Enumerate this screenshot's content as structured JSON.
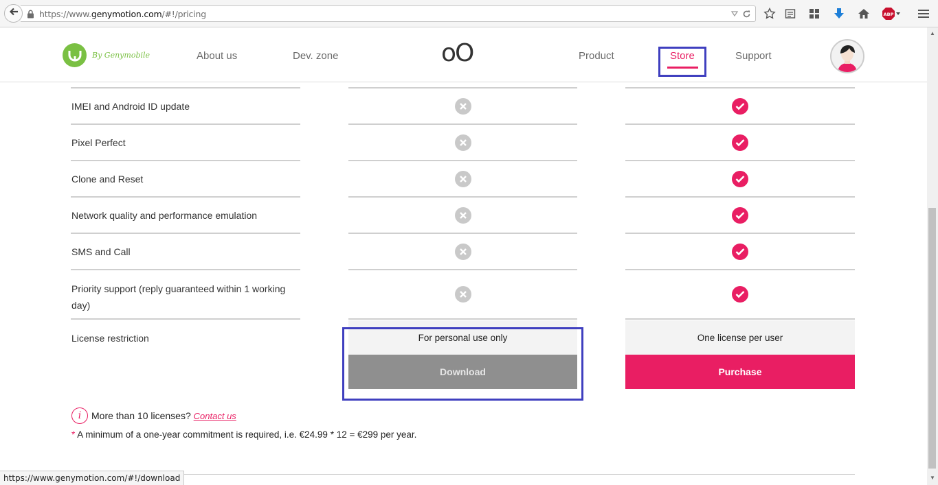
{
  "browser": {
    "url_prefix": "https://www.",
    "url_domain": "genymotion.com",
    "url_path": "/#!/pricing",
    "status_url": "https://www.genymotion.com/#!/download"
  },
  "header": {
    "logo_text": "By Genymobile",
    "nav_about": "About us",
    "nav_devzone": "Dev. zone",
    "brand_mark": "oO",
    "nav_product": "Product",
    "nav_store": "Store",
    "nav_support": "Support"
  },
  "features": [
    {
      "label": "IMEI and Android ID update",
      "free": false,
      "paid": true
    },
    {
      "label": "Pixel Perfect",
      "free": false,
      "paid": true
    },
    {
      "label": "Clone and Reset",
      "free": false,
      "paid": true
    },
    {
      "label": "Network quality and performance emulation",
      "free": false,
      "paid": true
    },
    {
      "label": "SMS and Call",
      "free": false,
      "paid": true
    },
    {
      "label": "Priority support (reply guaranteed within 1 working day)",
      "free": false,
      "paid": true
    }
  ],
  "license": {
    "label": "License restriction",
    "free_text": "For personal use only",
    "paid_text": "One license per user",
    "download_label": "Download",
    "purchase_label": "Purchase"
  },
  "notes": {
    "info_icon": "i",
    "more_licenses": "More than 10 licenses?",
    "contact_link": "Contact us",
    "footnote_star": "*",
    "footnote": "A minimum of a one-year commitment is required, i.e. €24.99 * 12 = €299 per year."
  },
  "colors": {
    "accent": "#e91e63",
    "logo_green": "#7ac043",
    "highlight": "#3f3fbf",
    "disabled_button": "#8f8f8f"
  },
  "icons": [
    "back-arrow-icon",
    "lock-icon",
    "dropdown-icon",
    "reload-icon",
    "bookmark-star-icon",
    "reading-list-icon",
    "grid-icon",
    "download-icon",
    "home-icon",
    "adblock-icon",
    "menu-icon",
    "info-icon",
    "cross-icon",
    "check-icon"
  ]
}
